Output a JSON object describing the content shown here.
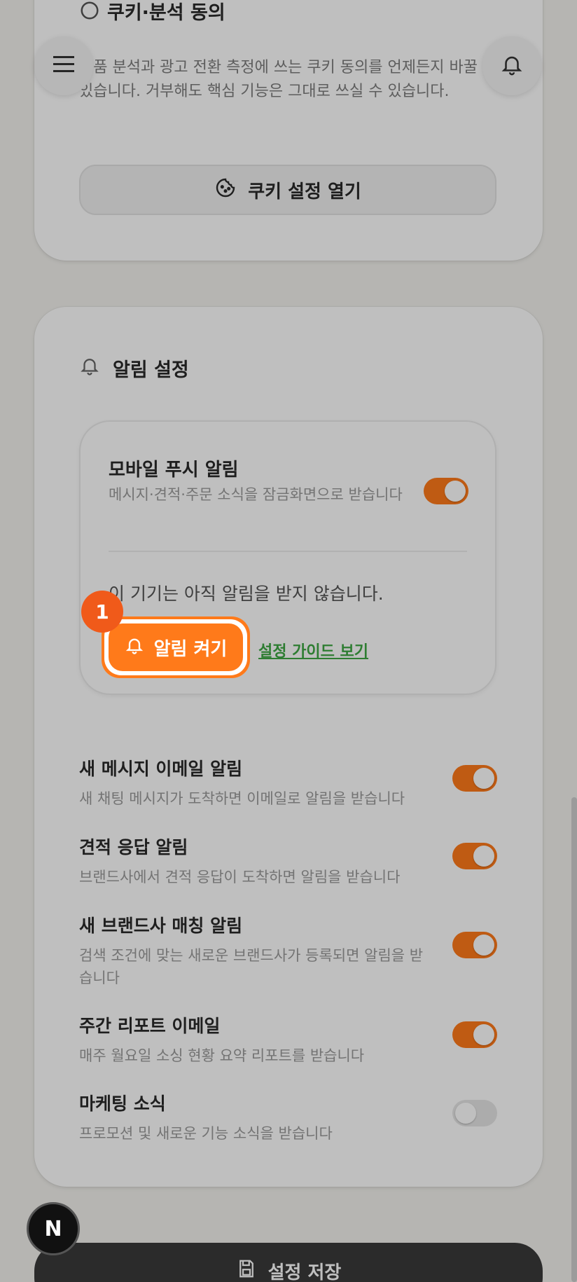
{
  "cookie": {
    "title": "쿠키·분석 동의",
    "desc": "제품 분석과 광고 전환 측정에 쓰는 쿠키 동의를 언제든지 바꿀 수 있습니다. 거부해도 핵심 기능은 그대로 쓰실 수 있습니다.",
    "button_label": "쿠키 설정 열기"
  },
  "notif": {
    "title": "알림 설정",
    "push": {
      "title": "모바일 푸시 알림",
      "desc": "메시지·견적·주문 소식을 잠금화면으로 받습니다",
      "enabled": true,
      "status": "이 기기는 아직 알림을 받지 않습니다.",
      "enable_label": "알림 켜기",
      "guide_label": "설정 가이드 보기"
    },
    "settings": [
      {
        "title": "새 메시지 이메일 알림",
        "desc": "새 채팅 메시지가 도착하면 이메일로 알림을 받습니다",
        "enabled": true
      },
      {
        "title": "견적 응답 알림",
        "desc": "브랜드사에서 견적 응답이 도착하면 알림을 받습니다",
        "enabled": true
      },
      {
        "title": "새 브랜드사 매칭 알림",
        "desc": "검색 조건에 맞는 새로운 브랜드사가 등록되면 알림을 받습니다",
        "enabled": true
      },
      {
        "title": "주간 리포트 이메일",
        "desc": "매주 월요일 소싱 현황 요약 리포트를 받습니다",
        "enabled": true
      },
      {
        "title": "마케팅 소식",
        "desc": "프로모션 및 새로운 기능 소식을 받습니다",
        "enabled": false
      }
    ]
  },
  "step_badge": "1",
  "save_label": "설정 저장",
  "n_badge": "N",
  "colors": {
    "accent": "#ff7a1a",
    "link": "#2e7d32",
    "badge": "#f05a1a"
  }
}
